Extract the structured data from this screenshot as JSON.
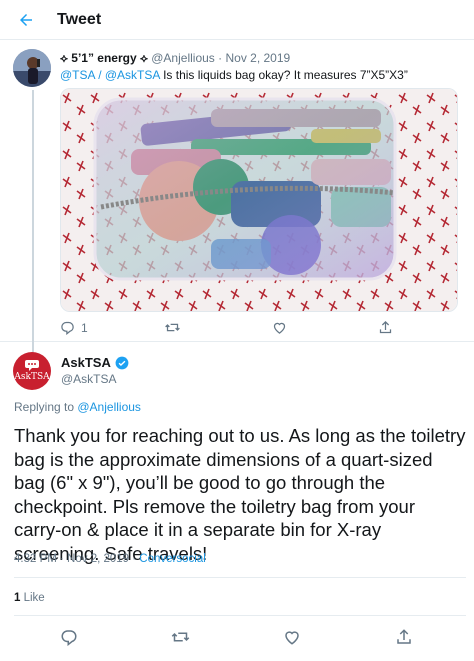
{
  "header": {
    "title": "Tweet",
    "back_icon": "back-arrow-icon",
    "accent": "#1da1f2"
  },
  "reply_context": {
    "display_name": "⟡ 5’1” energy ⟡",
    "handle": "@Anjellious",
    "date": "Nov 2, 2019",
    "separator": "·",
    "mentions": "@TSA / @AskTSA",
    "text": " Is this liquids bag okay? It measures 7”X5”X3”",
    "image_alt": "Clear toiletry bag with cosmetics on a patterned cloth",
    "actions": {
      "reply_count": "1",
      "retweet_count": "",
      "like_count": ""
    }
  },
  "main_tweet": {
    "display_name": "AskTSA",
    "verified": true,
    "handle": "@AskTSA",
    "avatar_text": "AskTSA",
    "avatar_color": "#c8202f",
    "replying_label": "Replying to ",
    "replying_to": "@Anjellious",
    "body": "Thank you for reaching out to us. As long as the toiletry bag is the approximate dimensions of a quart-sized bag (6\" x 9\"), you’ll be good to go through the checkpoint. Pls remove the toiletry bag from your carry-on & place it in a separate bin for X-ray screening. Safe travels!",
    "time": "4:32 PM · Nov 2, 2019 · ",
    "source": "Conversocial",
    "like_count": "1",
    "like_label": " Like"
  },
  "colors": {
    "link": "#1b95e0",
    "muted": "#657786",
    "divider": "#e6ecf0",
    "text": "#14171a"
  }
}
